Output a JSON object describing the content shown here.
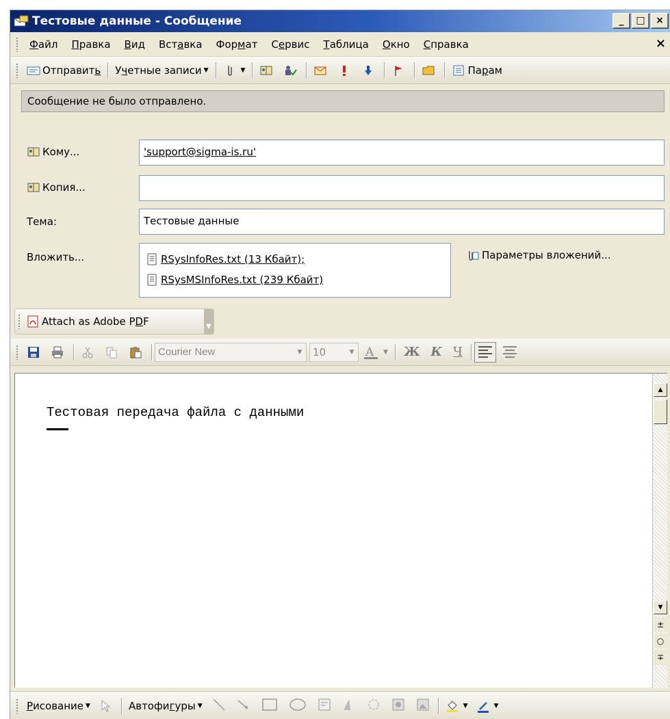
{
  "window": {
    "title": "Тестовые данные - Сообщение",
    "controls": {
      "minimize": "_",
      "maximize": "□",
      "close": "×"
    }
  },
  "menu": {
    "items": [
      {
        "pre": "",
        "ul": "Ф",
        "post": "айл"
      },
      {
        "pre": "",
        "ul": "П",
        "post": "равка"
      },
      {
        "pre": "",
        "ul": "В",
        "post": "ид"
      },
      {
        "pre": "Вст",
        "ul": "а",
        "post": "вка"
      },
      {
        "pre": "Фор",
        "ul": "м",
        "post": "ат"
      },
      {
        "pre": "С",
        "ul": "е",
        "post": "рвис"
      },
      {
        "pre": "",
        "ul": "Т",
        "post": "аблица"
      },
      {
        "pre": "",
        "ul": "О",
        "post": "кно"
      },
      {
        "pre": "",
        "ul": "С",
        "post": "правка"
      }
    ],
    "close_glyph": "×"
  },
  "toolbar": {
    "send_label": "Отправит",
    "send_ul": "ь",
    "accounts_pre": "У",
    "accounts_ul": "ч",
    "accounts_post": "етные записи",
    "params_pre": "Па",
    "params_ul": "р",
    "params_post": "ам"
  },
  "info": {
    "message": "Сообщение не было отправлено."
  },
  "fields": {
    "to_label": "Кому...",
    "to_value": "'support@sigma-is.ru'",
    "cc_label": "Копия...",
    "cc_value": "",
    "subject_label": "Тема:",
    "subject_value": "Тестовые данные",
    "attach_label": "Вложить...",
    "attachments": [
      "RSysInfoRes.txt (13 Кбайт);",
      "RSysMSInfoRes.txt (239 Кбайт)"
    ],
    "attach_params": "Параметры вложений..."
  },
  "pdf": {
    "label_pre": "Attach as Adobe P",
    "label_ul": "D",
    "label_post": "F"
  },
  "format": {
    "font": "Courier New",
    "size": "10",
    "bold": "Ж",
    "italic": "К",
    "underline": "Ч"
  },
  "body": {
    "text": "Тестовая передача файла с данными"
  },
  "drawing": {
    "draw_ul": "Р",
    "draw_post": "исование",
    "autoshapes_pre": "Автофи",
    "autoshapes_ul": "г",
    "autoshapes_post": "уры"
  },
  "colors": {
    "title_start": "#0a246a",
    "title_end": "#a6caf0",
    "chrome": "#ece9d8",
    "input_border": "#7f9db9"
  }
}
